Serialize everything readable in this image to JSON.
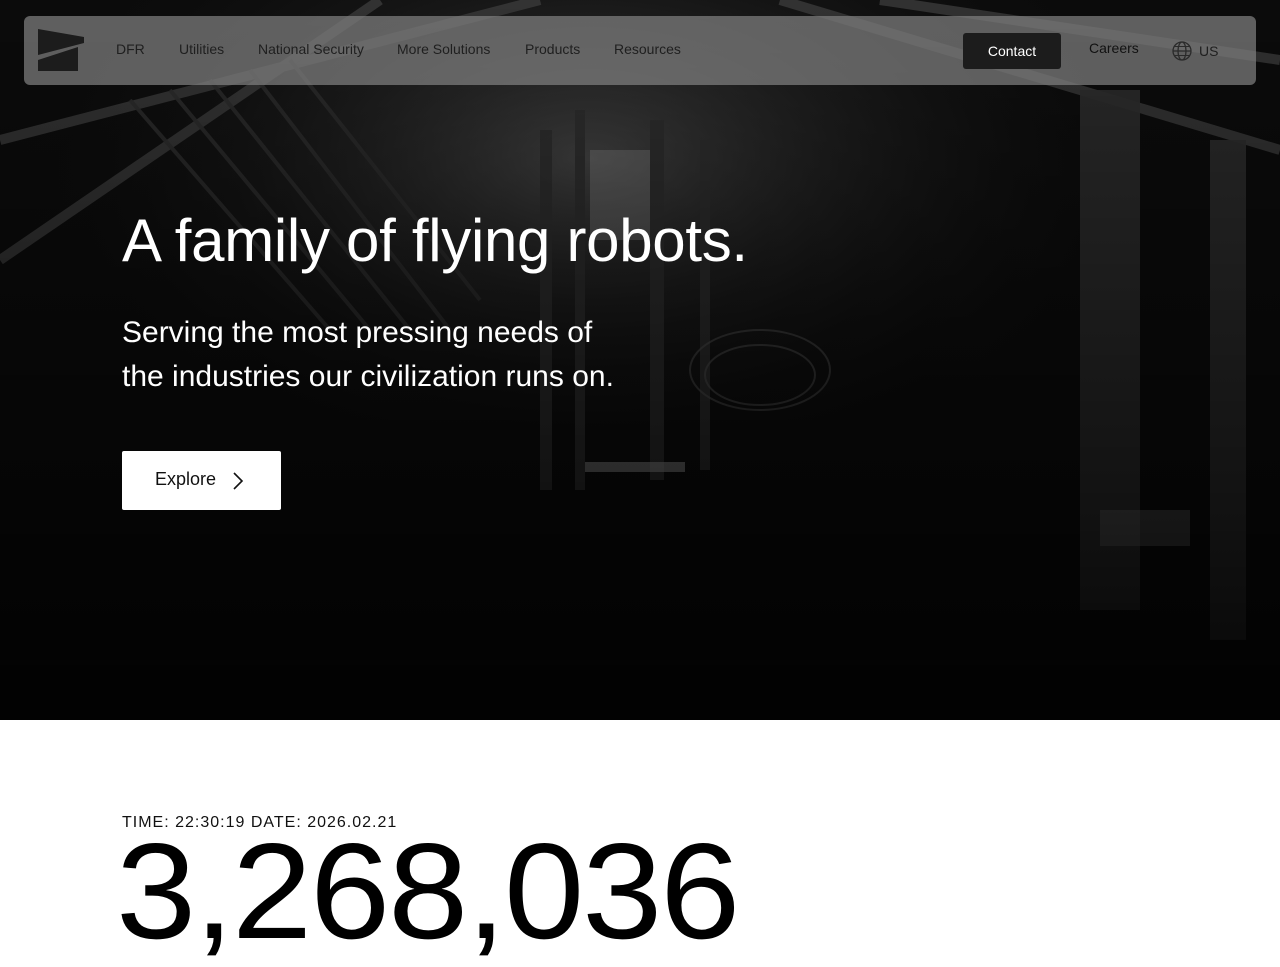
{
  "nav": {
    "logo_icon": "brand-logo-icon",
    "items": [
      {
        "label": "DFR"
      },
      {
        "label": "Utilities"
      },
      {
        "label": "National Security"
      },
      {
        "label": "More Solutions"
      },
      {
        "label": "Products"
      },
      {
        "label": "Resources"
      }
    ],
    "contact_label": "Contact",
    "careers_label": "Careers",
    "language": {
      "icon": "globe-icon",
      "label": "US"
    }
  },
  "hero": {
    "background_icon": "industrial-interior-photo",
    "title": "A family of flying robots.",
    "subtitle_lines": [
      "Serving the most pressing needs of",
      "the industries our civilization runs on."
    ],
    "cta": {
      "label": "Explore",
      "icon": "chevron-right-icon"
    }
  },
  "stats": {
    "timestamp": "TIME: 22:30:19 DATE: 2026.02.21",
    "counter": "3,268,036"
  },
  "colors": {
    "hero_background": "#060606",
    "navbar_background": "#808080",
    "contact_button": "#1c1c1c",
    "text_light": "#ffffff",
    "text_dark": "#111111"
  }
}
